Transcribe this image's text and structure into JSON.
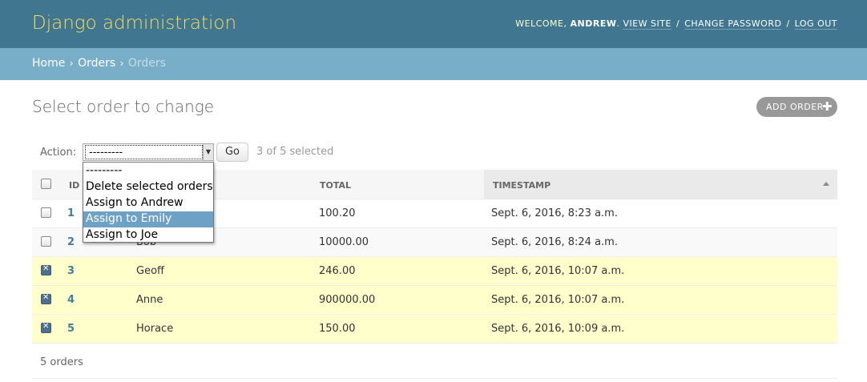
{
  "header": {
    "title": "Django administration",
    "welcome": "WELCOME,",
    "username": "ANDREW",
    "view_site": "VIEW SITE",
    "change_password": "CHANGE PASSWORD",
    "log_out": "LOG OUT",
    "separator": "/"
  },
  "breadcrumbs": {
    "home": "Home",
    "app": "Orders",
    "current": "Orders",
    "sep": "›"
  },
  "page": {
    "title": "Select order to change",
    "add_button": "ADD ORDER"
  },
  "actions": {
    "label": "Action:",
    "selected_value": "---------",
    "go": "Go",
    "selection_count": "3 of 5 selected",
    "options": [
      {
        "label": "---------",
        "highlighted": false
      },
      {
        "label": "Delete selected orders",
        "highlighted": false
      },
      {
        "label": "Assign to Andrew",
        "highlighted": false
      },
      {
        "label": "Assign to Emily",
        "highlighted": true
      },
      {
        "label": "Assign to Joe",
        "highlighted": false
      }
    ]
  },
  "table": {
    "columns": {
      "id": "ID",
      "total": "TOTAL",
      "timestamp": "TIMESTAMP"
    },
    "rows": [
      {
        "id": "1",
        "name": "",
        "total": "100.20",
        "timestamp": "Sept. 6, 2016, 8:23 a.m.",
        "selected": false
      },
      {
        "id": "2",
        "name": "Bob",
        "total": "10000.00",
        "timestamp": "Sept. 6, 2016, 8:24 a.m.",
        "selected": false
      },
      {
        "id": "3",
        "name": "Geoff",
        "total": "246.00",
        "timestamp": "Sept. 6, 2016, 10:07 a.m.",
        "selected": true
      },
      {
        "id": "4",
        "name": "Anne",
        "total": "900000.00",
        "timestamp": "Sept. 6, 2016, 10:07 a.m.",
        "selected": true
      },
      {
        "id": "5",
        "name": "Horace",
        "total": "150.00",
        "timestamp": "Sept. 6, 2016, 10:09 a.m.",
        "selected": true
      }
    ]
  },
  "paginator": {
    "text": "5 orders"
  },
  "colors": {
    "header_bg": "#417690",
    "breadcrumbs_bg": "#79aec8",
    "branding": "#f5dd5d",
    "selected_row": "#ffffcc",
    "link": "#447e9b"
  }
}
